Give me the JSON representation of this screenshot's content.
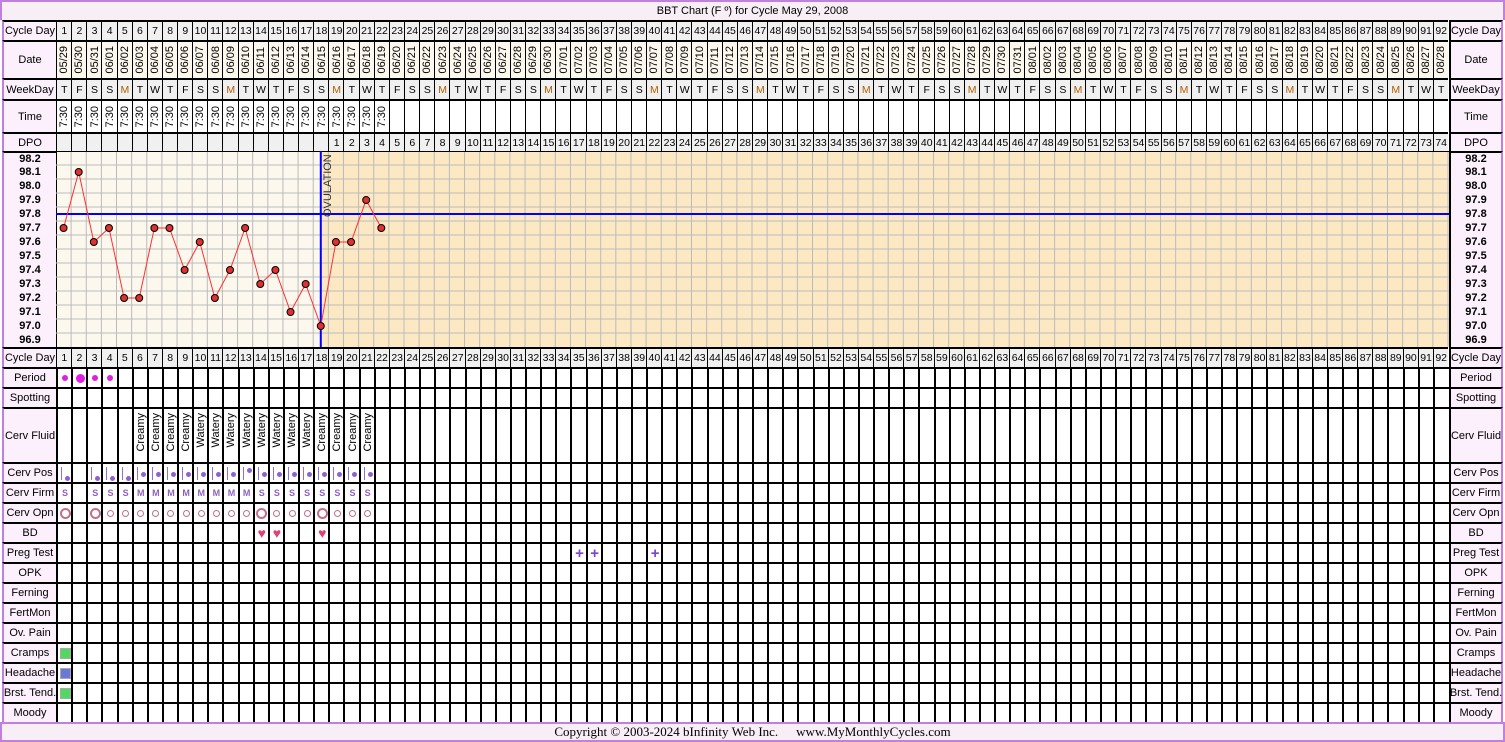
{
  "title": "BBT Chart (F º) for Cycle May 29, 2008",
  "footer": {
    "copyright": "Copyright © 2003-2024 bInfinity Web Inc.",
    "site": "www.MyMonthlyCycles.com"
  },
  "row_labels": {
    "cycle_day": "Cycle Day",
    "date": "Date",
    "weekday": "WeekDay",
    "time": "Time",
    "dpo": "DPO",
    "period": "Period",
    "spotting": "Spotting",
    "cerv_fluid": "Cerv Fluid",
    "cerv_pos": "Cerv Pos",
    "cerv_firm": "Cerv Firm",
    "cerv_opn": "Cerv Opn",
    "bd": "BD",
    "preg_test": "Preg Test",
    "opk": "OPK",
    "ferning": "Ferning",
    "fertmon": "FertMon",
    "ov_pain": "Ov. Pain",
    "cramps": "Cramps",
    "headache": "Headache",
    "brst_tend": "Brst. Tend.",
    "moody": "Moody"
  },
  "dates": [
    "05/29",
    "05/30",
    "05/31",
    "06/01",
    "06/02",
    "06/03",
    "06/04",
    "06/05",
    "06/06",
    "06/07",
    "06/08",
    "06/09",
    "06/10",
    "06/11",
    "06/12",
    "06/13",
    "06/14",
    "06/15",
    "06/16",
    "06/17",
    "06/18",
    "06/19",
    "06/20",
    "06/21",
    "06/22",
    "06/23",
    "06/24",
    "06/25",
    "06/26",
    "06/27",
    "06/28",
    "06/29",
    "06/30",
    "07/01",
    "07/02",
    "07/03",
    "07/04",
    "07/05",
    "07/06",
    "07/07",
    "07/08",
    "07/09",
    "07/10",
    "07/11",
    "07/12",
    "07/13",
    "07/14",
    "07/15",
    "07/16",
    "07/17",
    "07/18",
    "07/19",
    "07/20",
    "07/21",
    "07/22",
    "07/23",
    "07/24",
    "07/25",
    "07/26",
    "07/27",
    "07/28",
    "07/29",
    "07/30",
    "07/31",
    "08/01",
    "08/02",
    "08/03",
    "08/04",
    "08/05",
    "08/06",
    "08/07",
    "08/08",
    "08/09",
    "08/10",
    "08/11",
    "08/12",
    "08/13",
    "08/14",
    "08/15",
    "08/16",
    "08/17",
    "08/18",
    "08/19",
    "08/20",
    "08/21",
    "08/22",
    "08/23",
    "08/24",
    "08/25",
    "08/26",
    "08/27",
    "08/28"
  ],
  "weekday_cycle": [
    "T",
    "F",
    "S",
    "S",
    "M",
    "T",
    "W"
  ],
  "times": [
    "7:30",
    "7:30",
    "7:30",
    "7:30",
    "7:30",
    "7:30",
    "7:30",
    "7:30",
    "7:30",
    "7:30",
    "7:30",
    "7:30",
    "7:30",
    "7:30",
    "7:30",
    "7:30",
    "7:30",
    "7:30",
    "7:30",
    "7:30",
    "7:30",
    "7:30"
  ],
  "dpo_start_day": 19,
  "chart_data": {
    "type": "line",
    "y_ticks": [
      "98.2",
      "98.1",
      "98.0",
      "97.9",
      "97.8",
      "97.7",
      "97.6",
      "97.5",
      "97.4",
      "97.3",
      "97.2",
      "97.1",
      "97.0",
      "96.9"
    ],
    "ylim": [
      96.9,
      98.2
    ],
    "temperatures": [
      97.7,
      98.1,
      97.6,
      97.7,
      97.2,
      97.2,
      97.7,
      97.7,
      97.4,
      97.6,
      97.2,
      97.4,
      97.7,
      97.3,
      97.4,
      97.1,
      97.3,
      97.0,
      97.6,
      97.6,
      97.9,
      97.7
    ],
    "coverline": 97.8,
    "ovulation_day": 18,
    "ovulation_label": "OVULATION",
    "colors": {
      "line": "#ff3030",
      "point": "#e03030",
      "coverline": "#0000ff",
      "pre_bg": "#fdf8ee",
      "post_bg": "#fde8c4"
    }
  },
  "period": {
    "1": "light",
    "2": "heavy",
    "3": "light",
    "4": "light"
  },
  "cerv_fluid": {
    "6": "Creamy",
    "7": "Creamy",
    "8": "Creamy",
    "9": "Creamy",
    "10": "Watery",
    "11": "Watery",
    "12": "Watery",
    "13": "Watery",
    "14": "Watery",
    "15": "Watery",
    "16": "Watery",
    "17": "Watery",
    "18": "Creamy",
    "19": "Creamy",
    "20": "Creamy",
    "21": "Creamy"
  },
  "cerv_pos": {
    "1": "low",
    "3": "low",
    "4": "low",
    "5": "low",
    "6": "mid",
    "7": "mid",
    "8": "mid",
    "9": "mid",
    "10": "mid",
    "11": "mid",
    "12": "mid",
    "13": "high",
    "14": "mid",
    "15": "mid",
    "16": "mid",
    "17": "mid",
    "18": "mid",
    "19": "mid",
    "20": "mid",
    "21": "mid"
  },
  "cerv_firm": {
    "1": "S",
    "3": "S",
    "4": "S",
    "5": "S",
    "6": "M",
    "7": "M",
    "8": "M",
    "9": "M",
    "10": "M",
    "11": "M",
    "12": "M",
    "13": "M",
    "14": "S",
    "15": "S",
    "16": "S",
    "17": "S",
    "18": "S",
    "19": "S",
    "20": "S",
    "21": "S"
  },
  "cerv_opn": {
    "1": "open",
    "3": "open",
    "4": "closed",
    "5": "closed",
    "6": "closed",
    "7": "closed",
    "8": "closed",
    "9": "closed",
    "10": "closed",
    "11": "closed",
    "12": "closed",
    "13": "closed",
    "14": "open",
    "15": "closed",
    "16": "closed",
    "17": "closed",
    "18": "open",
    "19": "closed",
    "20": "closed",
    "21": "closed"
  },
  "bd": {
    "14": "♥",
    "15": "♥",
    "18": "♥"
  },
  "preg_test": {
    "35": "+",
    "36": "+",
    "40": "+"
  },
  "cramps": {
    "1": "#50d860"
  },
  "headache": {
    "1": "#6a78d8"
  },
  "brst_tend": {
    "1": "#50d860"
  }
}
